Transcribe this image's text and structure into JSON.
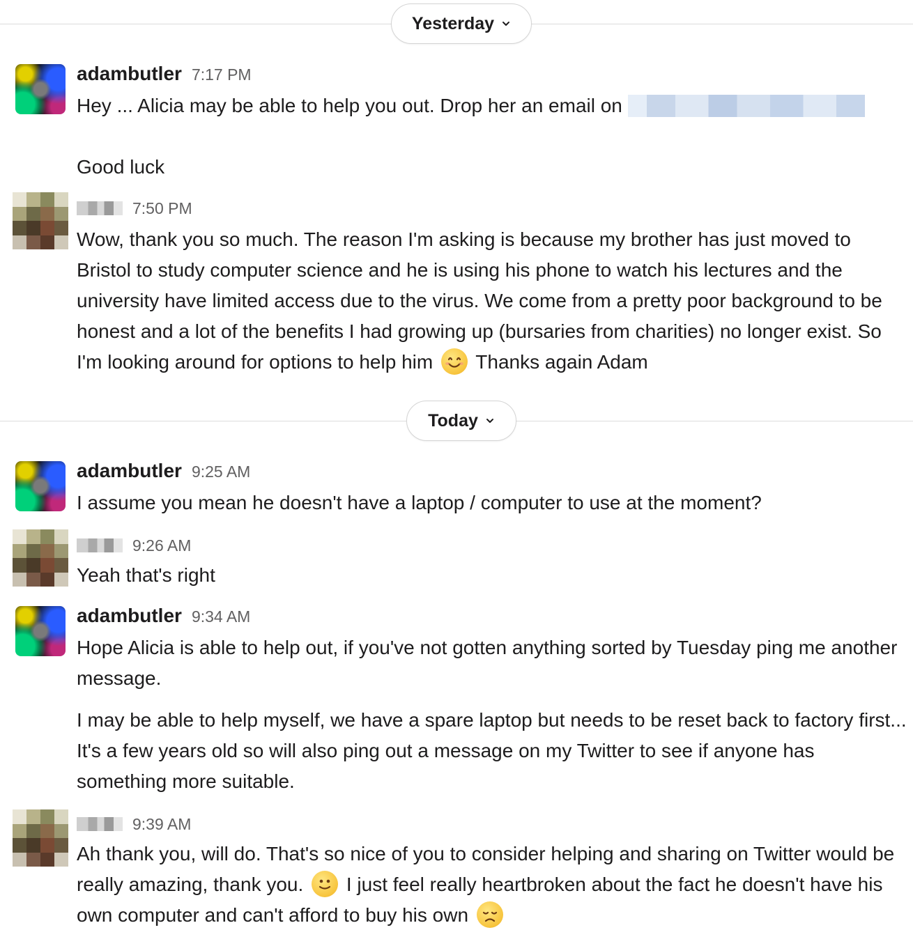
{
  "dividers": {
    "yesterday": {
      "label": "Yesterday"
    },
    "today": {
      "label": "Today"
    }
  },
  "messages": [
    {
      "author": "adambutler",
      "time": "7:17 PM",
      "text1": "Hey ... Alicia may be able to help you out. Drop her an email on",
      "text2": "Good luck"
    },
    {
      "author": "",
      "time": "7:50 PM",
      "text1": "Wow, thank you so much. The reason I'm asking is  because my brother has just moved to Bristol to study computer science and he is using his phone to watch his lectures and the university have limited access due to the virus. We come from a pretty poor background to be honest and a lot of the benefits I had growing up (bursaries from charities) no longer exist. So I'm looking around for options to help him",
      "text2": "Thanks again Adam"
    },
    {
      "author": "adambutler",
      "time": "9:25 AM",
      "text1": "I assume you mean he doesn't have a laptop / computer to use at the moment?"
    },
    {
      "author": "",
      "time": "9:26 AM",
      "text1": "Yeah that's right"
    },
    {
      "author": "adambutler",
      "time": "9:34 AM",
      "text1": "Hope Alicia is able to help out, if you've not gotten anything sorted by Tuesday ping me another message.",
      "text2": "I may be able to help myself, we have a spare laptop but needs to be reset back to factory first... It's a few years old so will also ping out a message on my Twitter to see if anyone has something more suitable."
    },
    {
      "author": "",
      "time": "9:39 AM",
      "text1": "Ah thank you, will do. That's so nice of you to consider helping and sharing on Twitter would be really amazing, thank you.",
      "text2": "I just feel really heartbroken about the fact he doesn't have his own computer and can't afford to buy his own"
    }
  ],
  "colors": {
    "text": "#1d1c1d",
    "timestamp": "#616061",
    "divider_line": "#dcdcdc"
  },
  "icons": {
    "chevron": "chevron-down-icon",
    "smile": "smiling-face-emoji",
    "slight_smile": "slightly-smiling-face-emoji",
    "disappointed": "disappointed-face-emoji"
  }
}
